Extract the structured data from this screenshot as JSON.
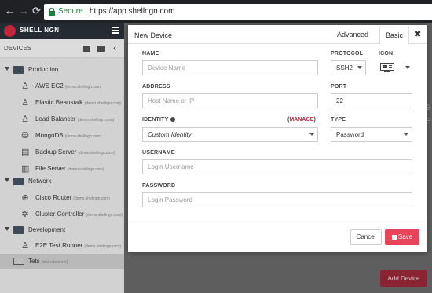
{
  "browser": {
    "back_icon": "←",
    "forward_icon": "→",
    "reload_icon": "⟳",
    "secure_label": "Secure",
    "url": "https://app.shellngn.com"
  },
  "app": {
    "logo_text": "SHELL NGN",
    "brand_color": "#c2253a"
  },
  "sidebar": {
    "title": "DEVICES",
    "collapse_icon": "‹",
    "tree": [
      {
        "type": "folder",
        "label": "Production"
      },
      {
        "type": "device",
        "icon": "linux-icon",
        "glyph": "♙",
        "label": "AWS EC2",
        "host": "(demo.shellngn.com)"
      },
      {
        "type": "device",
        "icon": "linux-icon",
        "glyph": "♙",
        "label": "Elastic Beanstalk",
        "host": "(demo.shellngn.com)"
      },
      {
        "type": "device",
        "icon": "linux-icon",
        "glyph": "♙",
        "label": "Load Balancer",
        "host": "(demo.shellngn.com)"
      },
      {
        "type": "device",
        "icon": "database-icon",
        "glyph": "⛁",
        "label": "MongoDB",
        "host": "(demo.shellngn.com)"
      },
      {
        "type": "device",
        "icon": "server-icon",
        "glyph": "▤",
        "label": "Backup Server",
        "host": "(demo.shellngn.com)"
      },
      {
        "type": "device",
        "icon": "server-icon",
        "glyph": "▥",
        "label": "File Server",
        "host": "(demo.shellngn.com)"
      },
      {
        "type": "folder",
        "label": "Network"
      },
      {
        "type": "device",
        "icon": "router-icon",
        "glyph": "⊕",
        "label": "Cisco Router",
        "host": "(demo.shellngn.com)"
      },
      {
        "type": "device",
        "icon": "cluster-icon",
        "glyph": "✲",
        "label": "Cluster Controller",
        "host": "(demo.shellngn.com)"
      },
      {
        "type": "folder",
        "label": "Development"
      },
      {
        "type": "device",
        "icon": "linux-icon",
        "glyph": "♙",
        "label": "E2E Test Runner",
        "host": "(demo.shellngn.com)"
      },
      {
        "type": "selected-device",
        "label": "Tets",
        "host": "(test.rebex.net)"
      }
    ]
  },
  "background": {
    "text_1": "e",
    "text_2": "e",
    "add_device_label": "Add Device"
  },
  "modal": {
    "title": "New Device",
    "tab_advanced": "Advanced",
    "tab_basic": "Basic",
    "close_icon": "✖",
    "name_label": "NAME",
    "name_placeholder": "Device Name",
    "protocol_label": "PROTOCOL",
    "protocol_value": "SSH2",
    "icon_label": "ICON",
    "address_label": "ADDRESS",
    "address_placeholder": "Host Name or IP",
    "port_label": "PORT",
    "port_value": "22",
    "identity_label": "IDENTITY",
    "manage_label": "MANAGE",
    "identity_value": "Custom Identity",
    "type_label": "TYPE",
    "type_value": "Password",
    "username_label": "USERNAME",
    "username_placeholder": "Login Username",
    "password_label": "PASSWORD",
    "password_placeholder": "Login Password",
    "cancel_label": "Cancel",
    "save_label": "Save"
  }
}
